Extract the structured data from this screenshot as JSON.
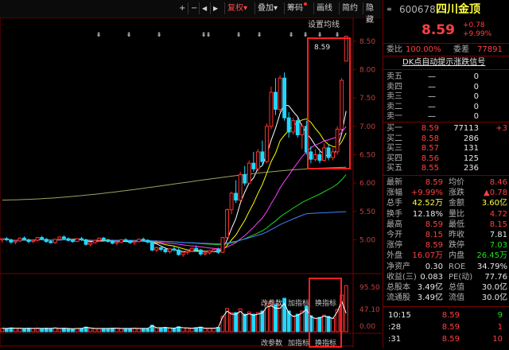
{
  "toolbar": {
    "nav": [
      "+",
      "−",
      "◀",
      "▶"
    ],
    "buttons": [
      {
        "label": "复权",
        "active": true,
        "caret": true
      },
      {
        "label": "叠加",
        "caret": true
      },
      {
        "label": "筹码",
        "dot": true
      },
      {
        "label": "画线"
      },
      {
        "label": "简约"
      },
      {
        "label": "隐藏"
      }
    ],
    "settings_label": "设置均线",
    "price_badge": "8.59",
    "bottom_tabs_top": [
      "改参数",
      "加指标",
      "换指标"
    ],
    "bottom_tabs_bottom": [
      "改参数",
      "加指标",
      "换指标"
    ]
  },
  "chart_data": {
    "type": "candlestick",
    "price_axis": {
      "ylim": [
        4.6,
        8.75
      ],
      "ticks": [
        "8.50",
        "8.00",
        "7.50",
        "7.00",
        "6.50",
        "6.00",
        "5.50",
        "5.00"
      ]
    },
    "volume_axis": {
      "ticks": [
        "95.50",
        "47.10",
        "0.00"
      ]
    },
    "candles": [
      [
        5.0,
        5.03,
        4.95,
        5.02
      ],
      [
        5.02,
        5.05,
        4.98,
        5.0
      ],
      [
        5.0,
        5.02,
        4.93,
        4.96
      ],
      [
        4.96,
        5.0,
        4.92,
        4.98
      ],
      [
        4.98,
        5.04,
        4.96,
        5.03
      ],
      [
        5.03,
        5.06,
        4.99,
        5.0
      ],
      [
        5.0,
        5.02,
        4.94,
        4.97
      ],
      [
        4.97,
        5.01,
        4.94,
        4.99
      ],
      [
        4.99,
        5.05,
        4.97,
        5.04
      ],
      [
        5.04,
        5.07,
        5.0,
        5.01
      ],
      [
        5.01,
        5.03,
        4.95,
        4.97
      ],
      [
        4.97,
        5.0,
        4.93,
        4.95
      ],
      [
        4.95,
        5.02,
        4.93,
        5.01
      ],
      [
        5.01,
        5.06,
        4.99,
        5.05
      ],
      [
        5.05,
        5.08,
        5.0,
        5.02
      ],
      [
        5.02,
        5.04,
        4.97,
        4.99
      ],
      [
        4.99,
        5.01,
        4.95,
        4.97
      ],
      [
        4.97,
        5.03,
        4.96,
        5.02
      ],
      [
        5.02,
        5.05,
        4.98,
        5.0
      ],
      [
        5.0,
        5.02,
        4.9,
        4.92
      ],
      [
        4.92,
        4.97,
        4.88,
        4.95
      ],
      [
        4.95,
        5.0,
        4.93,
        4.99
      ],
      [
        4.99,
        5.04,
        4.97,
        5.03
      ],
      [
        5.03,
        5.05,
        4.98,
        5.0
      ],
      [
        5.0,
        5.02,
        4.95,
        4.97
      ],
      [
        4.97,
        5.0,
        4.92,
        4.94
      ],
      [
        4.94,
        4.98,
        4.9,
        4.96
      ],
      [
        4.96,
        5.01,
        4.94,
        5.0
      ],
      [
        5.0,
        5.03,
        4.96,
        4.98
      ],
      [
        4.98,
        5.0,
        4.93,
        4.95
      ],
      [
        4.95,
        4.99,
        4.91,
        4.97
      ],
      [
        4.97,
        5.02,
        4.95,
        5.01
      ],
      [
        5.01,
        5.04,
        4.97,
        4.99
      ],
      [
        4.99,
        5.01,
        4.94,
        4.96
      ],
      [
        4.96,
        4.98,
        4.8,
        4.82
      ],
      [
        4.82,
        4.88,
        4.78,
        4.86
      ],
      [
        4.86,
        4.9,
        4.8,
        4.83
      ],
      [
        4.83,
        4.87,
        4.76,
        4.79
      ],
      [
        4.79,
        4.85,
        4.76,
        4.84
      ],
      [
        4.84,
        4.88,
        4.8,
        4.82
      ],
      [
        4.82,
        4.85,
        4.72,
        4.74
      ],
      [
        4.74,
        4.8,
        4.7,
        4.78
      ],
      [
        4.78,
        4.83,
        4.74,
        4.8
      ],
      [
        4.8,
        4.86,
        4.78,
        4.85
      ],
      [
        4.85,
        4.9,
        4.8,
        4.82
      ],
      [
        4.82,
        4.84,
        4.72,
        4.75
      ],
      [
        4.75,
        4.8,
        4.72,
        4.77
      ],
      [
        4.77,
        4.82,
        4.74,
        4.8
      ],
      [
        4.8,
        4.85,
        4.77,
        4.83
      ],
      [
        4.83,
        4.86,
        4.75,
        4.78
      ],
      [
        4.78,
        5.05,
        4.77,
        5.04
      ],
      [
        5.04,
        5.55,
        5.02,
        5.53
      ],
      [
        5.53,
        5.85,
        5.45,
        5.82
      ],
      [
        5.82,
        6.05,
        5.65,
        5.7
      ],
      [
        5.7,
        6.2,
        5.68,
        6.15
      ],
      [
        6.15,
        6.3,
        5.95,
        6.0
      ],
      [
        6.0,
        6.4,
        5.98,
        6.35
      ],
      [
        6.35,
        6.55,
        6.2,
        6.25
      ],
      [
        6.25,
        6.6,
        6.2,
        6.55
      ],
      [
        6.55,
        6.75,
        6.3,
        6.38
      ],
      [
        6.38,
        7.05,
        6.35,
        7.0
      ],
      [
        7.0,
        7.7,
        6.95,
        7.6
      ],
      [
        7.6,
        7.85,
        7.2,
        7.3
      ],
      [
        7.3,
        7.9,
        7.25,
        7.85
      ],
      [
        7.85,
        7.95,
        7.1,
        7.15
      ],
      [
        7.15,
        7.25,
        6.8,
        6.9
      ],
      [
        6.9,
        7.15,
        6.85,
        7.1
      ],
      [
        7.1,
        7.15,
        6.8,
        6.85
      ],
      [
        6.85,
        7.05,
        6.6,
        7.0
      ],
      [
        7.0,
        7.1,
        6.5,
        6.55
      ],
      [
        6.55,
        6.65,
        6.35,
        6.42
      ],
      [
        6.42,
        6.6,
        6.38,
        6.5
      ],
      [
        6.5,
        6.6,
        6.35,
        6.4
      ],
      [
        6.4,
        6.7,
        6.38,
        6.62
      ],
      [
        6.62,
        6.68,
        6.4,
        6.45
      ],
      [
        6.45,
        6.62,
        6.4,
        6.55
      ],
      [
        6.55,
        7.0,
        6.5,
        6.95
      ],
      [
        6.95,
        7.85,
        6.9,
        7.81
      ],
      [
        8.15,
        8.59,
        8.15,
        8.59
      ]
    ]
  },
  "stock": {
    "code": "600678",
    "name": "四川金顶",
    "price": "8.59",
    "change": "+0.78",
    "change_pct": "+9.99%",
    "weibi_label": "委比",
    "weibi": "100.00%",
    "weicha_label": "委差",
    "weicha": "77891",
    "signal_link": "DK点自动提示涨跌信号"
  },
  "sell_orders": [
    {
      "label": "卖五",
      "price": "—",
      "vol": "0"
    },
    {
      "label": "卖四",
      "price": "—",
      "vol": "0"
    },
    {
      "label": "卖三",
      "price": "—",
      "vol": "0"
    },
    {
      "label": "卖二",
      "price": "—",
      "vol": "0"
    },
    {
      "label": "卖一",
      "price": "—",
      "vol": "0"
    }
  ],
  "buy_orders": [
    {
      "label": "买一",
      "price": "8.59",
      "vol": "77113",
      "diff": "+3"
    },
    {
      "label": "买二",
      "price": "8.58",
      "vol": "286",
      "diff": ""
    },
    {
      "label": "买三",
      "price": "8.57",
      "vol": "131",
      "diff": ""
    },
    {
      "label": "买四",
      "price": "8.56",
      "vol": "125",
      "diff": ""
    },
    {
      "label": "买五",
      "price": "8.55",
      "vol": "236",
      "diff": ""
    }
  ],
  "stats": [
    {
      "l1": "最新",
      "v1": "8.59",
      "c1": "red",
      "l2": "均价",
      "v2": "8.46",
      "c2": "red"
    },
    {
      "l1": "涨幅",
      "v1": "+9.99%",
      "c1": "red",
      "l2": "涨跌",
      "v2": "▲0.78",
      "c2": "red"
    },
    {
      "l1": "总手",
      "v1": "42.52万",
      "c1": "yellow",
      "l2": "金额",
      "v2": "3.60亿",
      "c2": "yellow"
    },
    {
      "l1": "换手",
      "v1": "12.18%",
      "c1": "white",
      "l2": "量比",
      "v2": "4.72",
      "c2": "red"
    },
    {
      "l1": "最高",
      "v1": "8.59",
      "c1": "red",
      "l2": "最低",
      "v2": "8.15",
      "c2": "red"
    },
    {
      "l1": "今开",
      "v1": "8.15",
      "c1": "red",
      "l2": "昨收",
      "v2": "7.81",
      "c2": "white"
    },
    {
      "l1": "涨停",
      "v1": "8.59",
      "c1": "red",
      "l2": "跌停",
      "v2": "7.03",
      "c2": "green"
    },
    {
      "l1": "外盘",
      "v1": "16.07万",
      "c1": "red",
      "l2": "内盘",
      "v2": "26.45万",
      "c2": "green"
    },
    {
      "l1": "净资产",
      "v1": "0.30",
      "c1": "white",
      "l2": "ROE",
      "v2": "34.79%",
      "c2": "white"
    },
    {
      "l1": "收益(三)",
      "v1": "0.083",
      "c1": "white",
      "l2": "PE(动)",
      "v2": "77.76",
      "c2": "white"
    },
    {
      "l1": "总股本",
      "v1": "3.49亿",
      "c1": "white",
      "l2": "总值",
      "v2": "30.0亿",
      "c2": "white"
    },
    {
      "l1": "流通股",
      "v1": "3.49亿",
      "c1": "white",
      "l2": "流值",
      "v2": "30.0亿",
      "c2": "white"
    }
  ],
  "ticks": [
    {
      "time": "10:15",
      "price": "8.59",
      "vol": "9"
    },
    {
      "time": ":28",
      "price": "8.59",
      "vol": "1"
    },
    {
      "time": ":31",
      "price": "8.59",
      "vol": "10"
    }
  ],
  "colors": {
    "up": "#ff3030",
    "down": "#20d8ff",
    "highlight": "#ff2020",
    "border": "#7a0000"
  }
}
